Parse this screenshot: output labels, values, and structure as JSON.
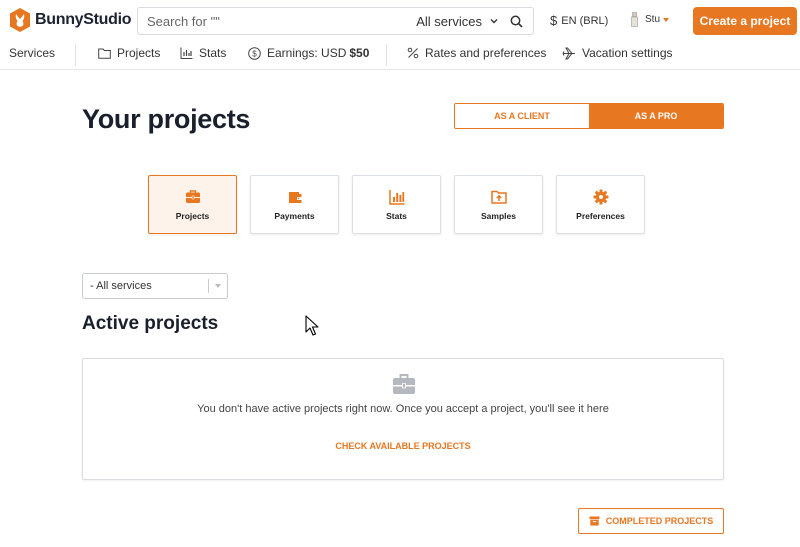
{
  "header": {
    "brand": "BunnyStudio",
    "search_placeholder": "Search for \"\"",
    "search_scope": "All services",
    "currency_symbol": "$",
    "language": "EN (BRL)",
    "user_name": "Stu",
    "create_button": "Create a project"
  },
  "nav": {
    "services": "Services",
    "projects": "Projects",
    "stats": "Stats",
    "earnings_label": "Earnings: USD",
    "earnings_amount": "$50",
    "rates": "Rates and preferences",
    "vacation": "Vacation settings"
  },
  "page": {
    "title": "Your projects",
    "toggle_client": "AS A CLIENT",
    "toggle_pro": "AS A PRO",
    "toggle_active": "pro"
  },
  "cards": [
    {
      "label": "Projects",
      "icon": "briefcase-icon",
      "active": true
    },
    {
      "label": "Payments",
      "icon": "wallet-icon",
      "active": false
    },
    {
      "label": "Stats",
      "icon": "bar-chart-icon",
      "active": false
    },
    {
      "label": "Samples",
      "icon": "folder-upload-icon",
      "active": false
    },
    {
      "label": "Preferences",
      "icon": "gear-icon",
      "active": false
    }
  ],
  "filter": {
    "value": "- All services"
  },
  "active_projects": {
    "title": "Active projects",
    "empty_message": "You don't have active projects right now. Once you accept a project, you'll see it here",
    "cta": "CHECK AVAILABLE PROJECTS"
  },
  "completed_button": "COMPLETED PROJECTS",
  "colors": {
    "accent": "#e87722",
    "text_dark": "#1a1f2c",
    "border": "#d9dbe0",
    "active_card_bg": "#fdf3ea"
  }
}
